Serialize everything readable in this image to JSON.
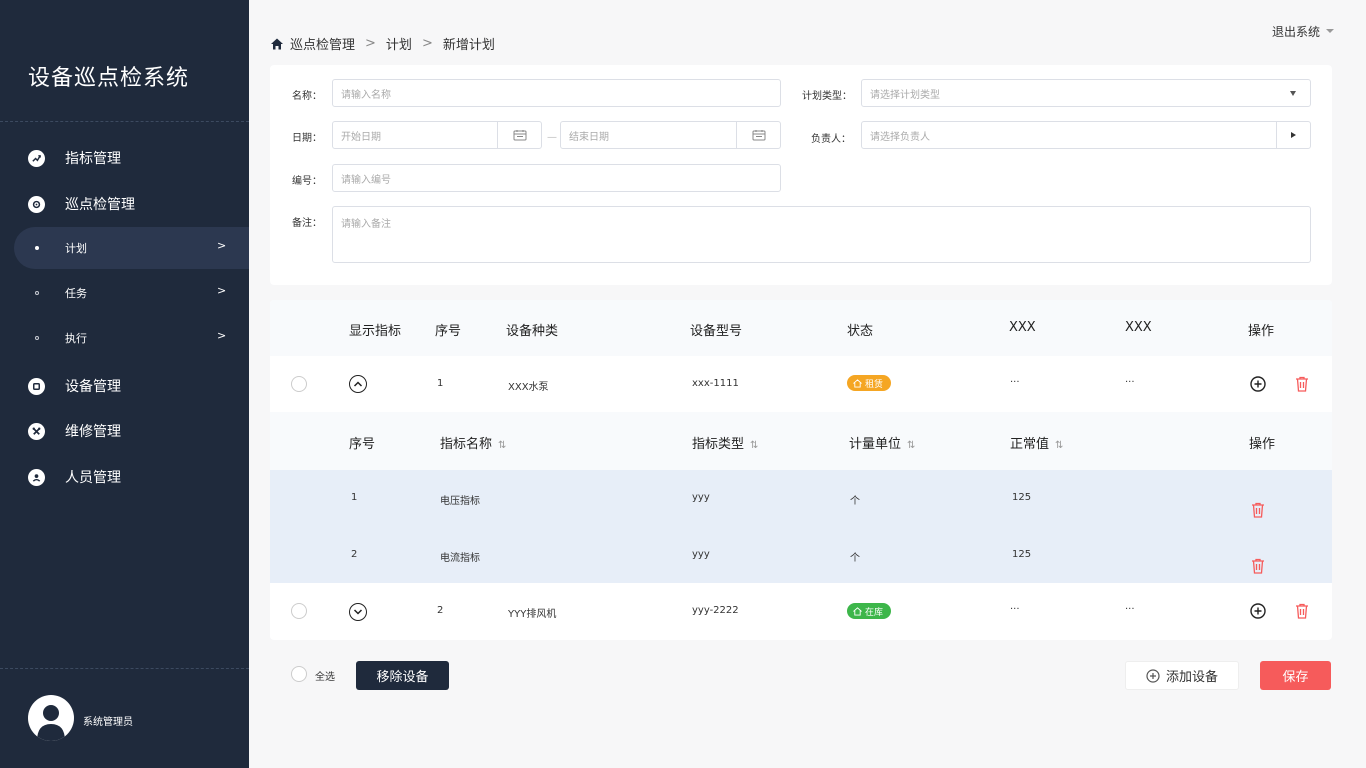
{
  "app": {
    "title": "设备巡点检系统"
  },
  "sidebar": {
    "items": [
      {
        "label": "指标管理",
        "icon": "trend-icon"
      },
      {
        "label": "巡点检管理",
        "icon": "target-icon"
      },
      {
        "label": "设备管理",
        "icon": "device-icon"
      },
      {
        "label": "维修管理",
        "icon": "wrench-icon"
      },
      {
        "label": "人员管理",
        "icon": "user-icon"
      }
    ],
    "subitems": [
      {
        "label": "计划",
        "arrow": ">"
      },
      {
        "label": "任务",
        "arrow": ">"
      },
      {
        "label": "执行",
        "arrow": ">"
      }
    ],
    "user": "系统管理员"
  },
  "header": {
    "breadcrumb": [
      "巡点检管理",
      ">",
      "计划",
      ">",
      "新增计划"
    ],
    "logout": "退出系统"
  },
  "form": {
    "name_label": "名称：",
    "name_placeholder": "请输入名称",
    "type_label": "计划类型：",
    "type_placeholder": "请选择计划类型",
    "date_label": "日期：",
    "start_placeholder": "开始日期",
    "end_placeholder": "结束日期",
    "range_sep": "—",
    "owner_label": "负责人：",
    "owner_placeholder": "请选择负责人",
    "code_label": "编号：",
    "code_placeholder": "请输入编号",
    "note_label": "备注：",
    "note_placeholder": "请输入备注"
  },
  "table": {
    "headers": [
      "显示指标",
      "序号",
      "设备种类",
      "设备型号",
      "状态",
      "XXX",
      "XXX",
      "操作"
    ],
    "rows": [
      {
        "no": "1",
        "kind": "XXX水泵",
        "model": "xxx-1111",
        "status": "租赁",
        "status_color": "#f5a623",
        "x1": "···",
        "x2": "···"
      },
      {
        "no": "2",
        "kind": "YYY排风机",
        "model": "yyy-2222",
        "status": "在库",
        "status_color": "#3db64a",
        "x1": "···",
        "x2": "···"
      }
    ],
    "sub_headers": [
      "序号",
      "指标名称",
      "指标类型",
      "计量单位",
      "正常值",
      "操作"
    ],
    "sort_icon": "⇅",
    "sub_rows": [
      {
        "no": "1",
        "name": "电压指标",
        "type": "yyy",
        "unit": "个",
        "normal": "125"
      },
      {
        "no": "2",
        "name": "电流指标",
        "type": "yyy",
        "unit": "个",
        "normal": "125"
      }
    ]
  },
  "footer": {
    "select_all": "全选",
    "remove": "移除设备",
    "add": "添加设备",
    "save": "保存"
  },
  "colors": {
    "sidebar_bg": "#1f2a3c",
    "danger": "#f65b5b",
    "rent": "#f5a623",
    "stock": "#3db64a"
  }
}
